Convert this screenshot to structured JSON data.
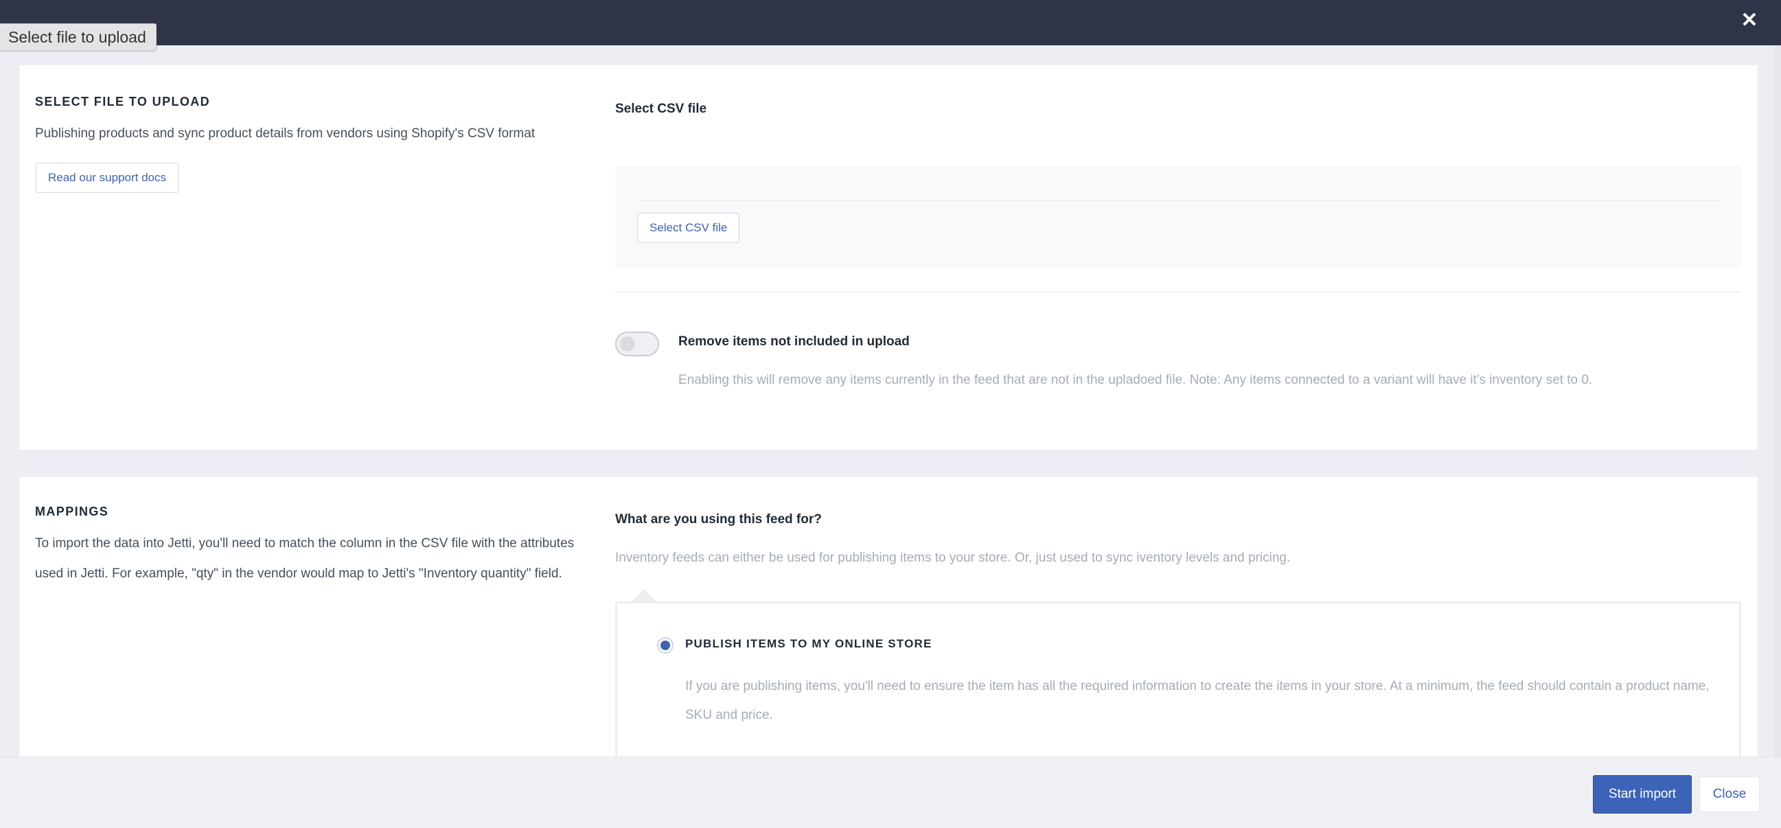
{
  "window": {
    "tab_label": "Select file to upload",
    "close_icon": "close-icon"
  },
  "upload_section": {
    "title": "SELECT FILE TO UPLOAD",
    "description": "Publishing products and sync product details from vendors using Shopify's CSV format",
    "support_button": "Read our support docs",
    "field_title": "Select CSV file",
    "select_button": "Select CSV file",
    "remove_toggle": {
      "label": "Remove items not included in upload",
      "description": "Enabling this will remove any items currently in the feed that are not in the upladoed file. Note: Any items connected to a variant will have it's inventory set to 0.",
      "enabled": false
    }
  },
  "mappings_section": {
    "title": "MAPPINGS",
    "description_line1": "To import the data into Jetti, you'll need to match the column in the CSV file with the attributes",
    "description_line2": "used in Jetti. For example, \"qty\" in the vendor would map to Jetti's \"Inventory quantity\" field.",
    "question": "What are you using this feed for?",
    "question_help": "Inventory feeds can either be used for publishing items to your store. Or, just used to sync iventory levels and pricing.",
    "options": [
      {
        "label": "PUBLISH ITEMS TO MY ONLINE STORE",
        "description": "If you are publishing items, you'll need to ensure the item has all the required information to create the items in your store. At a minimum, the feed should contain a product name, SKU and price.",
        "selected": true
      }
    ]
  },
  "footer": {
    "start_import": "Start import",
    "close": "Close"
  },
  "colors": {
    "accent": "#3c63b8",
    "topbar": "#2f3447",
    "background": "#eceef3"
  }
}
